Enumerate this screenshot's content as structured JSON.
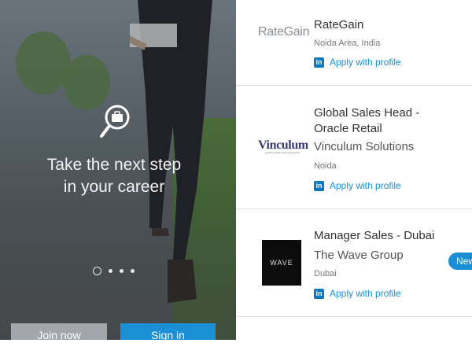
{
  "onboarding": {
    "headline_line1": "Take the next step",
    "headline_line2": "in your career",
    "icon": "briefcase-search-icon",
    "carousel": {
      "count": 4,
      "active_index": 0
    },
    "join_label": "Join now",
    "signin_label": "Sign in"
  },
  "jobs": [
    {
      "logo_text": "RateGain",
      "title": "RateGain",
      "company": "",
      "location": "Noida Area, India",
      "apply_label": "Apply with profile"
    },
    {
      "logo_text": "Vinculum",
      "logo_tagline": "Enabling Multi Channel Retailing",
      "title_line1": "Global Sales Head -",
      "title_line2": "Oracle Retail",
      "company": "Vinculum Solutions",
      "location": "Noida",
      "apply_label": "Apply with profile"
    },
    {
      "logo_text": "WAVE",
      "title": "Manager Sales - Dubai",
      "company": "The Wave Group",
      "location": "Dubai",
      "apply_label": "Apply with profile",
      "badge": "New"
    }
  ],
  "colors": {
    "accent": "#1a8fd6",
    "linkedin": "#0a78c0",
    "join_button": "#a3a7ab"
  }
}
